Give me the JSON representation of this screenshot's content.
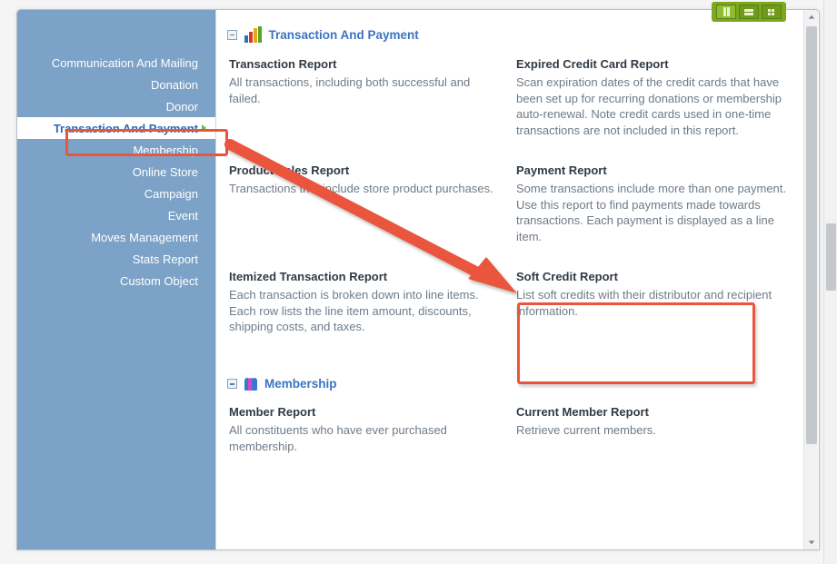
{
  "sidebar": {
    "items": [
      {
        "label": "Communication And Mailing",
        "selected": false
      },
      {
        "label": "Donation",
        "selected": false
      },
      {
        "label": "Donor",
        "selected": false
      },
      {
        "label": "Transaction And Payment",
        "selected": true
      },
      {
        "label": "Membership",
        "selected": false
      },
      {
        "label": "Online Store",
        "selected": false
      },
      {
        "label": "Campaign",
        "selected": false
      },
      {
        "label": "Event",
        "selected": false
      },
      {
        "label": "Moves Management",
        "selected": false
      },
      {
        "label": "Stats Report",
        "selected": false
      },
      {
        "label": "Custom Object",
        "selected": false
      }
    ]
  },
  "sections": {
    "transaction": {
      "title": "Transaction And Payment",
      "reports": [
        {
          "title": "Transaction Report",
          "desc": "All transactions, including both successful and failed."
        },
        {
          "title": "Expired Credit Card Report",
          "desc": "Scan expiration dates of the credit cards that have been set up for recurring donations or membership auto-renewal. Note credit cards used in one-time transactions are not included in this report."
        },
        {
          "title": "Product Sales Report",
          "desc": "Transactions that include store product purchases."
        },
        {
          "title": "Payment Report",
          "desc": "Some transactions include more than one payment. Use this report to find payments made towards transactions. Each payment is displayed as a line item."
        },
        {
          "title": "Itemized Transaction Report",
          "desc": "Each transaction is broken down into line items. Each row lists the line item amount, discounts, shipping costs, and taxes."
        },
        {
          "title": "Soft Credit Report",
          "desc": "List soft credits with their distributor and recipient information."
        }
      ]
    },
    "membership": {
      "title": "Membership",
      "reports": [
        {
          "title": "Member Report",
          "desc": "All constituents who have ever purchased membership."
        },
        {
          "title": "Current Member Report",
          "desc": "Retrieve current members."
        }
      ]
    }
  }
}
